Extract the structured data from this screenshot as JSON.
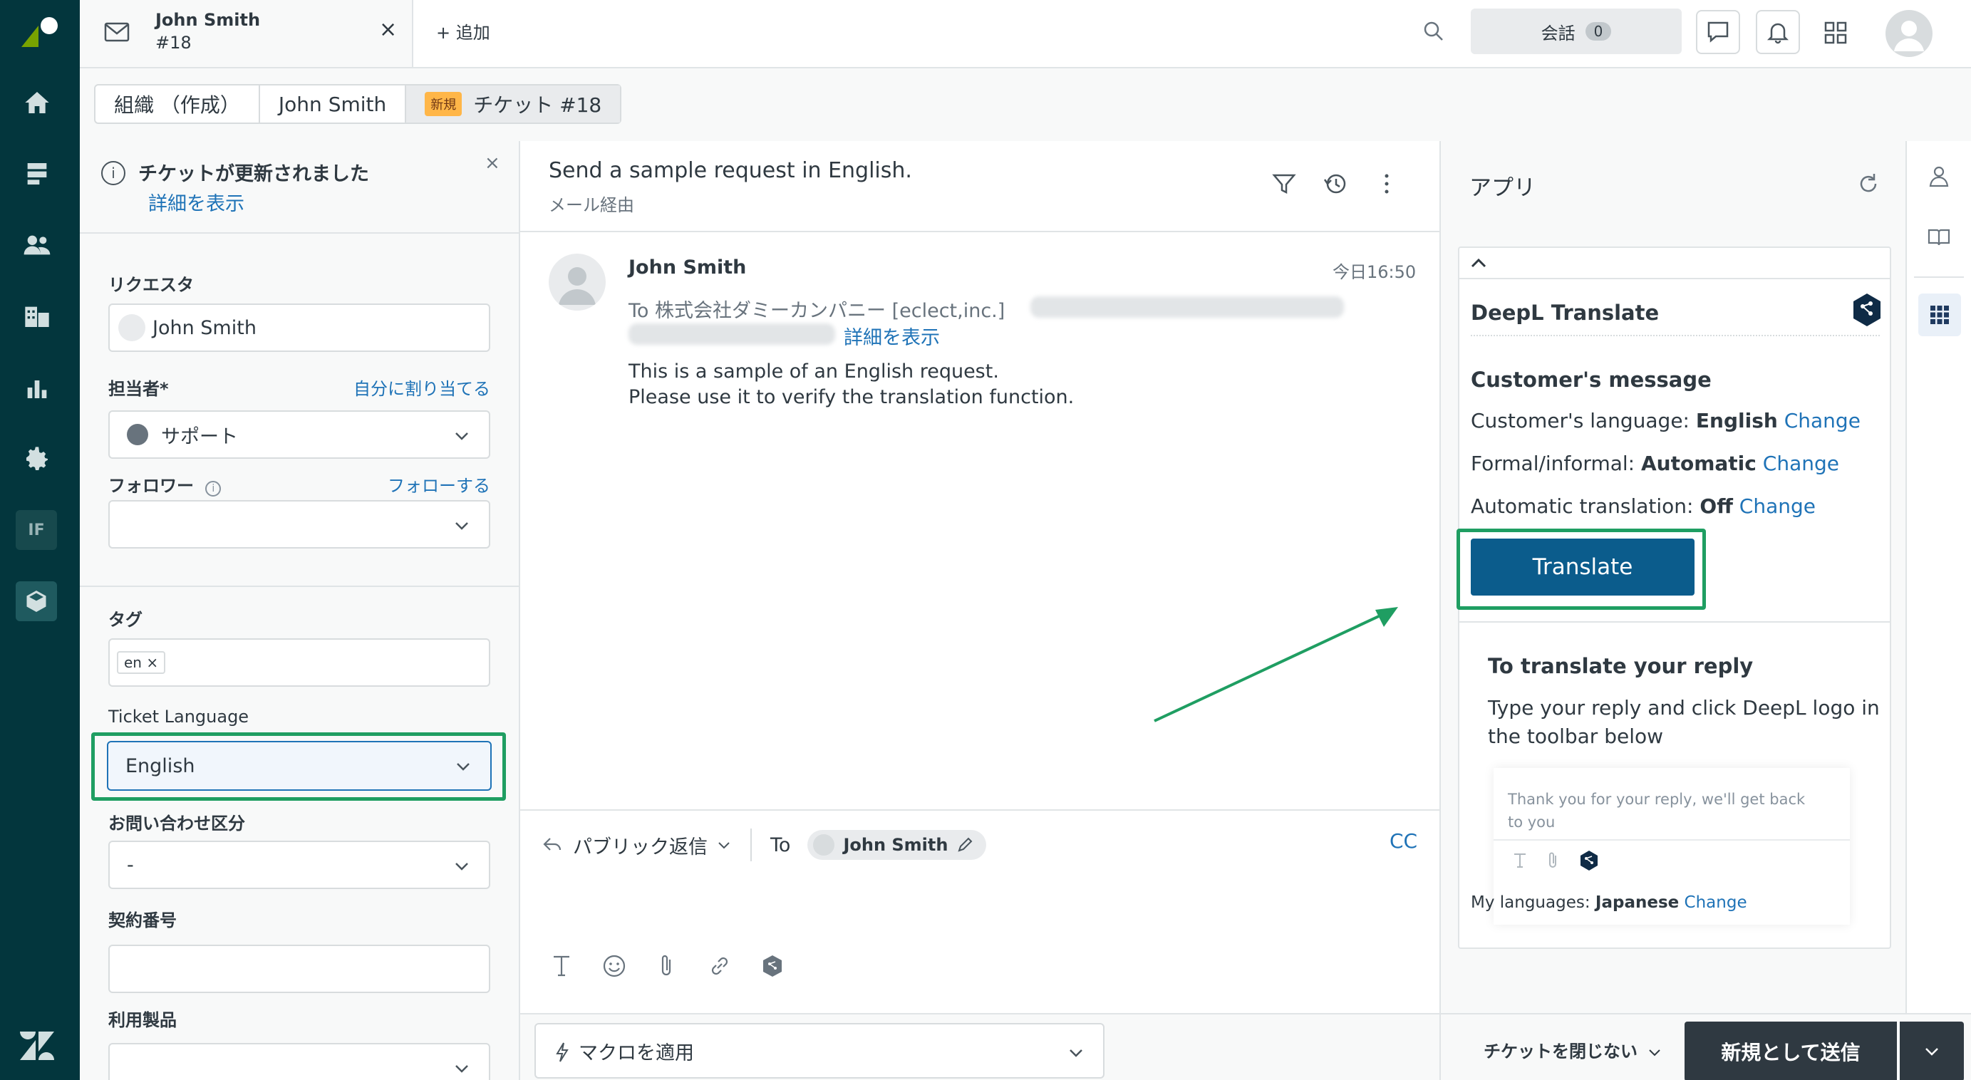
{
  "tab": {
    "name": "John Smith",
    "number": "#18",
    "add_label": "+ 追加"
  },
  "top": {
    "conversations_label": "会話",
    "conversations_count": "0"
  },
  "breadcrumb": {
    "org": "組織 （作成）",
    "user": "John Smith",
    "status_badge": "新規",
    "ticket": "チケット #18"
  },
  "notice": {
    "title": "チケットが更新されました",
    "link": "詳細を表示"
  },
  "fields": {
    "requester_label": "リクエスタ",
    "requester_value": "John Smith",
    "assignee_label": "担当者*",
    "assign_self": "自分に割り当てる",
    "assignee_value": "サポート",
    "followers_label": "フォロワー",
    "follow_link": "フォローする",
    "tags_label": "タグ",
    "tag_value": "en",
    "ticket_language_label": "Ticket Language",
    "ticket_language_value": "English",
    "inquiry_label": "お問い合わせ区分",
    "inquiry_value": "-",
    "contract_label": "契約番号",
    "product_label": "利用製品"
  },
  "conversation": {
    "subject": "Send a sample request in English.",
    "via": "メール経由",
    "sender": "John Smith",
    "time": "今日16:50",
    "to_line": "To 株式会社ダミーカンパニー [eclect,inc.]",
    "show_details": "詳細を表示",
    "body_line1": "This is a sample of an English request.",
    "body_line2": "Please use it to verify the translation function.",
    "reply_type": "パブリック返信",
    "to_label": "To",
    "to_name": "John Smith",
    "cc": "CC",
    "macro_label": "マクロを適用"
  },
  "apps": {
    "title": "アプリ",
    "deepl_title": "DeepL Translate",
    "customer_message": "Customer's message",
    "customer_language_label": "Customer's language:",
    "customer_language_value": "English",
    "formal_label": "Formal/informal:",
    "formal_value": "Automatic",
    "auto_label": "Automatic translation:",
    "auto_value": "Off",
    "change": "Change",
    "translate_btn": "Translate",
    "reply_title": "To translate your reply",
    "reply_desc": "Type your reply and click DeepL logo in the toolbar below",
    "sample_text": "Thank you for your reply, we'll get back to you",
    "my_languages_label": "My languages:",
    "my_languages_value": "Japanese"
  },
  "footer": {
    "close_option": "チケットを閉じない",
    "submit": "新規として送信"
  },
  "colors": {
    "nav": "#03363d",
    "link": "#1f73b7",
    "deepl_button": "#0b5c8c",
    "highlight": "#1f9e62",
    "submit": "#2f3941"
  }
}
